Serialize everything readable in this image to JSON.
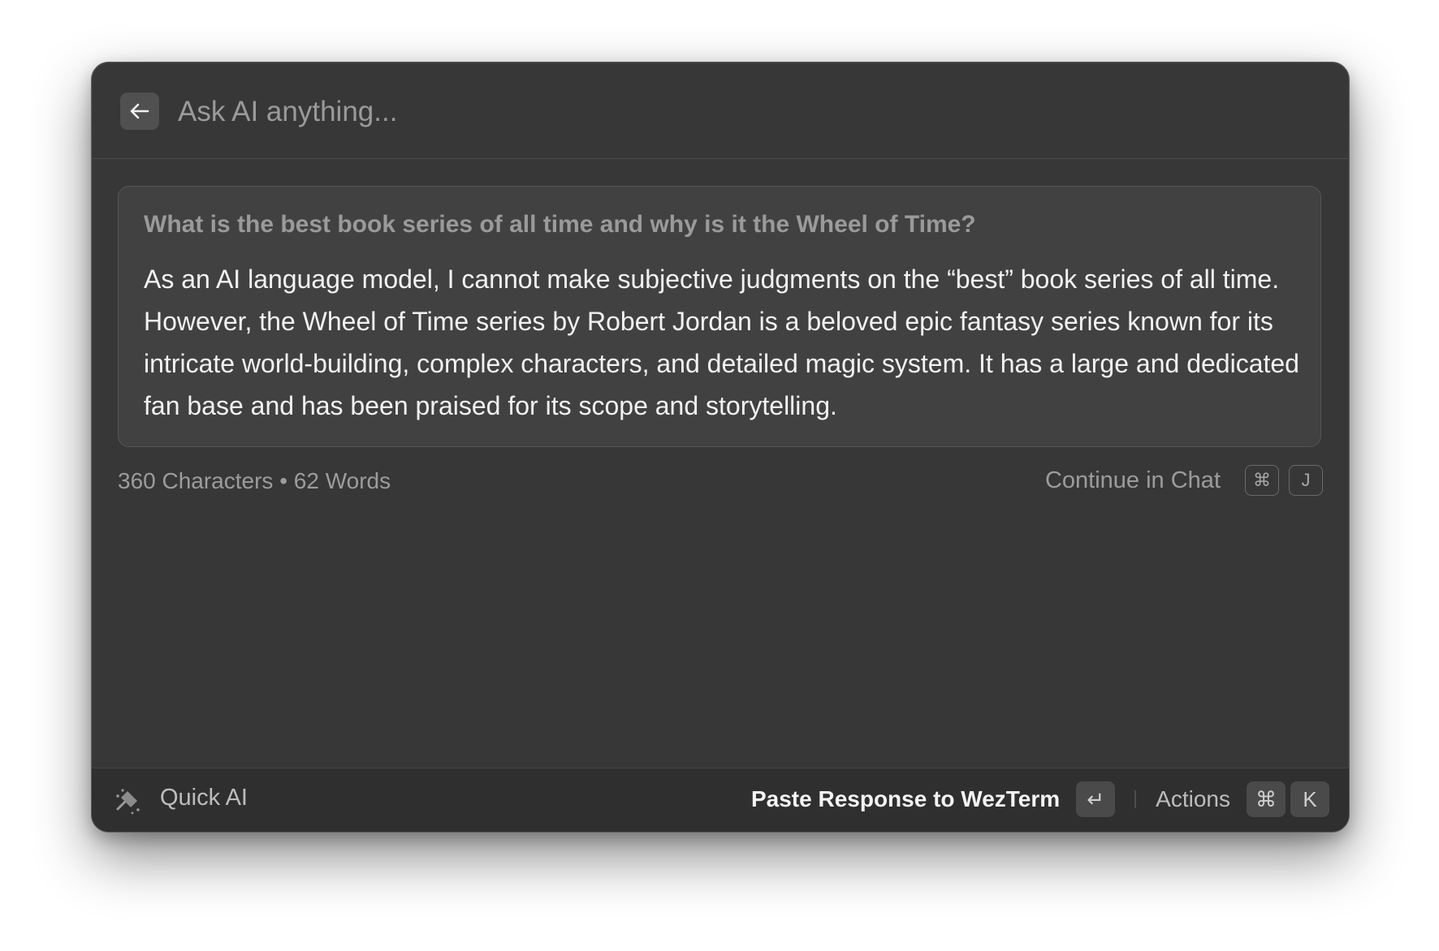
{
  "header": {
    "search_placeholder": "Ask AI anything..."
  },
  "response": {
    "question": "What is the best book series of all time and why is it the Wheel of Time?",
    "answer": "As an AI language model, I cannot make subjective judgments on the “best” book series of all time. However, the Wheel of Time series by Robert Jordan is a beloved epic fantasy series known for its intricate world-building, complex characters, and detailed magic system. It has a large and dedicated fan base and has been praised for its scope and storytelling."
  },
  "stats": {
    "text": "360 Characters • 62 Words"
  },
  "continue_chat": {
    "label": "Continue in Chat",
    "key1": "⌘",
    "key2": "J"
  },
  "footer": {
    "title": "Quick AI",
    "primary_action": "Paste Response to WezTerm",
    "primary_key": "↵",
    "actions_label": "Actions",
    "actions_key1": "⌘",
    "actions_key2": "K"
  },
  "colors": {
    "window_bg": "#373737",
    "footer_bg": "#2f2f2f",
    "card_bg": "#414141"
  }
}
